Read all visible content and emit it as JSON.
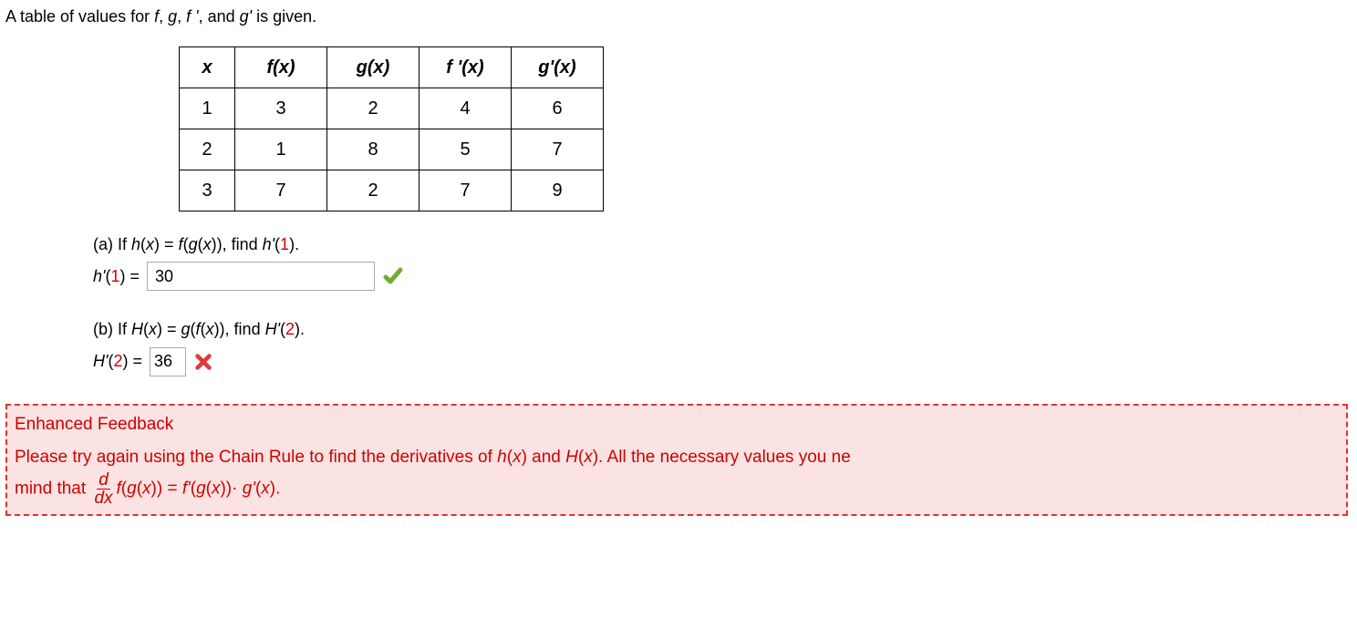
{
  "intro": {
    "prefix": "A table of values for ",
    "f": "f",
    "c1": ", ",
    "g": "g",
    "c2": ", ",
    "fp": "f '",
    "c3": ", and ",
    "gp": "g'",
    "suffix": " is given."
  },
  "table": {
    "headers": {
      "x": "x",
      "fx": "f(x)",
      "gx": "g(x)",
      "fpx": "f '(x)",
      "gpx": "g'(x)"
    },
    "rows": [
      {
        "x": "1",
        "fx": "3",
        "gx": "2",
        "fpx": "4",
        "gpx": "6"
      },
      {
        "x": "2",
        "fx": "1",
        "gx": "8",
        "fpx": "5",
        "gpx": "7"
      },
      {
        "x": "3",
        "fx": "7",
        "gx": "2",
        "fpx": "7",
        "gpx": "9"
      }
    ]
  },
  "partA": {
    "label_a": "(a) If ",
    "hx": "h",
    "paren_open": "(",
    "x": "x",
    "paren_close": ")",
    "eq": " = ",
    "f": "f",
    "g": "g",
    "tail": ")), find ",
    "hp": "h'",
    "one": "1",
    "dot": ".",
    "answer_label_h": "h'",
    "answer_label_open": "(",
    "answer_label_one": "1",
    "answer_label_close": ") = ",
    "answer_value": "30"
  },
  "partB": {
    "label_b": "(b) If  ",
    "Hx": "H",
    "paren_open": "(",
    "x": "x",
    "paren_close": ")",
    "eq": " = ",
    "g": "g",
    "f": "f",
    "tail": ")), find ",
    "Hp": "H'",
    "two": "2",
    "dot": ".",
    "answer_label_H": "H'",
    "answer_label_open": "(",
    "answer_label_two": "2",
    "answer_label_close": ") = ",
    "answer_value": "36"
  },
  "feedback": {
    "title": "Enhanced Feedback",
    "line1_a": "Please try again using the Chain Rule to find the derivatives of  ",
    "hx": "h",
    "po": "(",
    "x": "x",
    "pc": ")",
    "and": "  and  ",
    "Hx": "H",
    "line1_b": ".  All the necessary values you ne",
    "line2_a": "mind that  ",
    "d": "d",
    "dx": "dx",
    "f": "f",
    "g": "g",
    "eq": " = ",
    "fp": "f'",
    "dotg": "))· ",
    "gp": "g'",
    "end": ")."
  }
}
